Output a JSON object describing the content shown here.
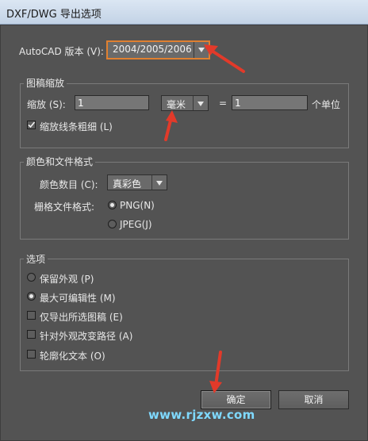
{
  "window": {
    "title": "DXF/DWG 导出选项"
  },
  "autocad": {
    "label": "AutoCAD 版本 (V):",
    "value": "2004/2005/2006"
  },
  "scale_group": {
    "title": "图稿缩放",
    "scale_label": "缩放 (S):",
    "scale_value": "1",
    "unit_value": "毫米",
    "equals": "=",
    "units_value": "1",
    "units_suffix": "个单位",
    "scale_lines_label": "缩放线条粗细 (L)",
    "scale_lines_checked": true
  },
  "color_group": {
    "title": "颜色和文件格式",
    "colors_label": "颜色数目 (C):",
    "colors_value": "真彩色",
    "raster_label": "栅格文件格式:",
    "png_label": "PNG(N)",
    "jpeg_label": "JPEG(J)",
    "selected_format": "PNG"
  },
  "options_group": {
    "title": "选项",
    "preserve_label": "保留外观 (P)",
    "editability_label": "最大可编辑性 (M)",
    "export_selected_label": "仅导出所选图稿 (E)",
    "alter_paths_label": "针对外观改变路径 (A)",
    "outline_text_label": "轮廓化文本 (O)",
    "selected_radio": "最大可编辑性"
  },
  "buttons": {
    "ok": "确定",
    "cancel": "取消"
  },
  "watermark": "www.rjzxw.com",
  "colors": {
    "panel": "#535353",
    "annotation_arrow": "#e23a2a",
    "watermark": "#7fd9ff",
    "highlight_border": "#e08030"
  }
}
